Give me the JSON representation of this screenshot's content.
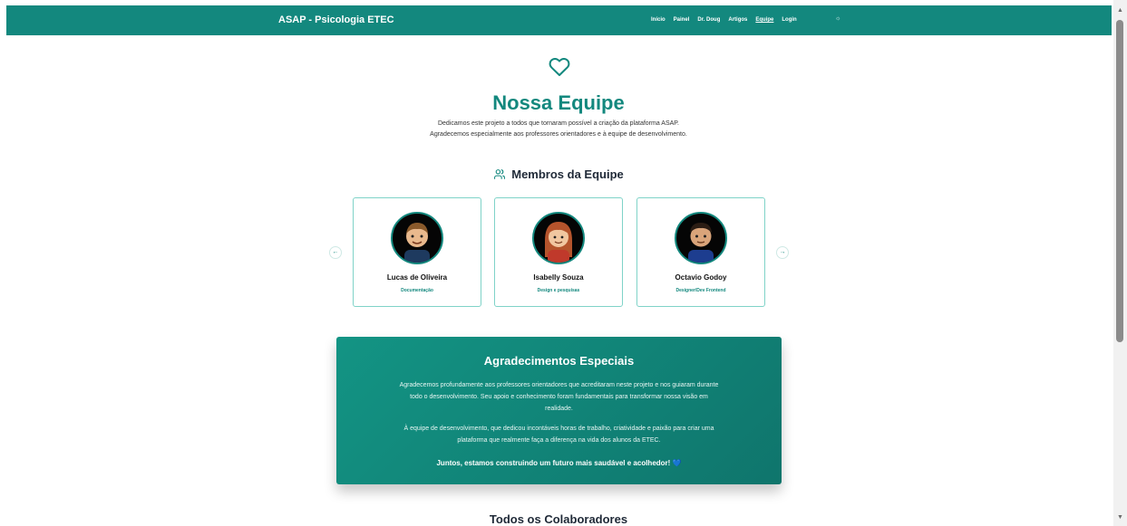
{
  "nav": {
    "brand": "ASAP - Psicologia ETEC",
    "links": [
      "Início",
      "Painel",
      "Dr. Doug",
      "Artigos",
      "Equipe",
      "Login"
    ],
    "active": "Equipe",
    "theme_icon": "sun-icon"
  },
  "hero": {
    "icon": "heart-icon",
    "title": "Nossa Equipe",
    "intro_line1": "Dedicamos este projeto a todos que tornaram possível a criação da plataforma ASAP.",
    "intro_line2": "Agradecemos especialmente aos professores orientadores e à equipe de desenvolvimento."
  },
  "team": {
    "title": "Membros da Equipe",
    "icon": "users-icon",
    "prev_icon": "arrow-left-icon",
    "next_icon": "arrow-right-icon",
    "members": [
      {
        "name": "Lucas de Oliveira",
        "role": "Documentação"
      },
      {
        "name": "Isabelly Souza",
        "role": "Design e pesquisas"
      },
      {
        "name": "Octavio Godoy",
        "role": "Designer/Dev Frontend"
      }
    ]
  },
  "thanks": {
    "title": "Agradecimentos Especiais",
    "p1": "Agradecemos profundamente aos professores orientadores que acreditaram neste projeto e nos guiaram durante todo o desenvolvimento. Seu apoio e conhecimento foram fundamentais para transformar nossa visão em realidade.",
    "p2": "À equipe de desenvolvimento, que dedicou incontáveis horas de trabalho, criatividade e paixão para criar uma plataforma que realmente faça a diferença na vida dos alunos da ETEC.",
    "closing": "Juntos, estamos construindo um futuro mais saudável e acolhedor!",
    "closing_icon": "💙"
  },
  "collaborators": {
    "title": "Todos os Colaboradores"
  },
  "colors": {
    "brand": "#13887e",
    "card_border": "#7fd3c8",
    "accent_blue": "#3b82f6"
  }
}
